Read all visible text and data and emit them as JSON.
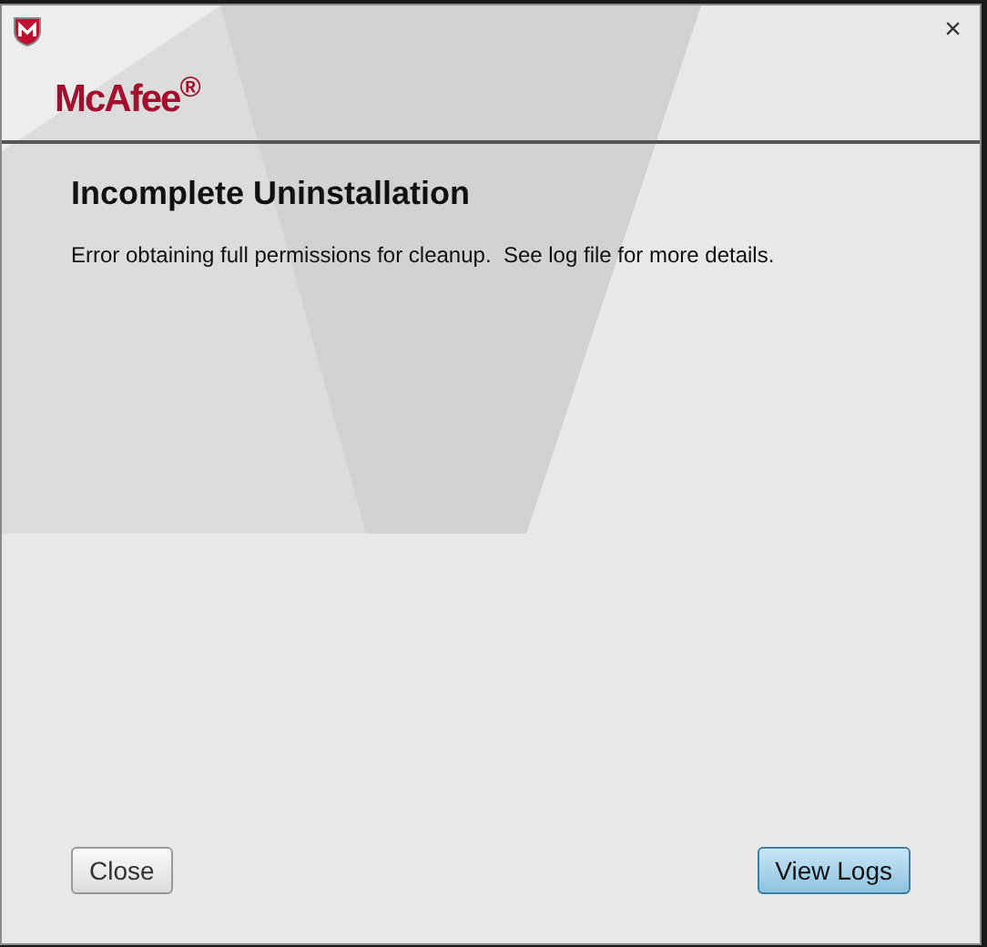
{
  "window": {
    "close_glyph": "×"
  },
  "header": {
    "logo": "McAfee$^{®}$"
  },
  "content": {
    "title": "Incomplete Uninstallation",
    "message": "Error obtaining full permissions for cleanup.  See log file for more details."
  },
  "buttons": [
    {
      "label": "Close",
      "kind": "normal"
    },
    {
      "label": "View Logs",
      "kind": "default"
    }
  ]
}
